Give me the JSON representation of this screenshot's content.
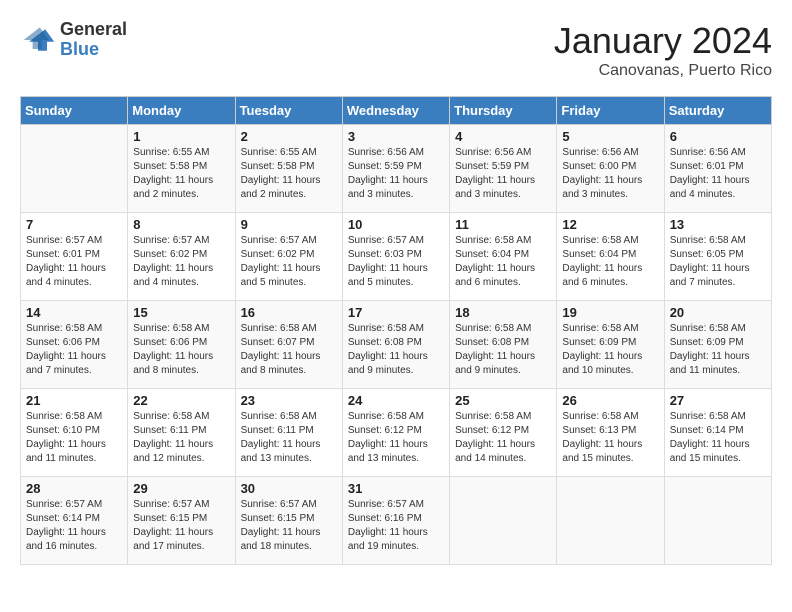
{
  "header": {
    "logo_general": "General",
    "logo_blue": "Blue",
    "month_title": "January 2024",
    "location": "Canovanas, Puerto Rico"
  },
  "days_of_week": [
    "Sunday",
    "Monday",
    "Tuesday",
    "Wednesday",
    "Thursday",
    "Friday",
    "Saturday"
  ],
  "weeks": [
    [
      {
        "day": "",
        "sunrise": "",
        "sunset": "",
        "daylight": ""
      },
      {
        "day": "1",
        "sunrise": "Sunrise: 6:55 AM",
        "sunset": "Sunset: 5:58 PM",
        "daylight": "Daylight: 11 hours and 2 minutes."
      },
      {
        "day": "2",
        "sunrise": "Sunrise: 6:55 AM",
        "sunset": "Sunset: 5:58 PM",
        "daylight": "Daylight: 11 hours and 2 minutes."
      },
      {
        "day": "3",
        "sunrise": "Sunrise: 6:56 AM",
        "sunset": "Sunset: 5:59 PM",
        "daylight": "Daylight: 11 hours and 3 minutes."
      },
      {
        "day": "4",
        "sunrise": "Sunrise: 6:56 AM",
        "sunset": "Sunset: 5:59 PM",
        "daylight": "Daylight: 11 hours and 3 minutes."
      },
      {
        "day": "5",
        "sunrise": "Sunrise: 6:56 AM",
        "sunset": "Sunset: 6:00 PM",
        "daylight": "Daylight: 11 hours and 3 minutes."
      },
      {
        "day": "6",
        "sunrise": "Sunrise: 6:56 AM",
        "sunset": "Sunset: 6:01 PM",
        "daylight": "Daylight: 11 hours and 4 minutes."
      }
    ],
    [
      {
        "day": "7",
        "sunrise": "Sunrise: 6:57 AM",
        "sunset": "Sunset: 6:01 PM",
        "daylight": "Daylight: 11 hours and 4 minutes."
      },
      {
        "day": "8",
        "sunrise": "Sunrise: 6:57 AM",
        "sunset": "Sunset: 6:02 PM",
        "daylight": "Daylight: 11 hours and 4 minutes."
      },
      {
        "day": "9",
        "sunrise": "Sunrise: 6:57 AM",
        "sunset": "Sunset: 6:02 PM",
        "daylight": "Daylight: 11 hours and 5 minutes."
      },
      {
        "day": "10",
        "sunrise": "Sunrise: 6:57 AM",
        "sunset": "Sunset: 6:03 PM",
        "daylight": "Daylight: 11 hours and 5 minutes."
      },
      {
        "day": "11",
        "sunrise": "Sunrise: 6:58 AM",
        "sunset": "Sunset: 6:04 PM",
        "daylight": "Daylight: 11 hours and 6 minutes."
      },
      {
        "day": "12",
        "sunrise": "Sunrise: 6:58 AM",
        "sunset": "Sunset: 6:04 PM",
        "daylight": "Daylight: 11 hours and 6 minutes."
      },
      {
        "day": "13",
        "sunrise": "Sunrise: 6:58 AM",
        "sunset": "Sunset: 6:05 PM",
        "daylight": "Daylight: 11 hours and 7 minutes."
      }
    ],
    [
      {
        "day": "14",
        "sunrise": "Sunrise: 6:58 AM",
        "sunset": "Sunset: 6:06 PM",
        "daylight": "Daylight: 11 hours and 7 minutes."
      },
      {
        "day": "15",
        "sunrise": "Sunrise: 6:58 AM",
        "sunset": "Sunset: 6:06 PM",
        "daylight": "Daylight: 11 hours and 8 minutes."
      },
      {
        "day": "16",
        "sunrise": "Sunrise: 6:58 AM",
        "sunset": "Sunset: 6:07 PM",
        "daylight": "Daylight: 11 hours and 8 minutes."
      },
      {
        "day": "17",
        "sunrise": "Sunrise: 6:58 AM",
        "sunset": "Sunset: 6:08 PM",
        "daylight": "Daylight: 11 hours and 9 minutes."
      },
      {
        "day": "18",
        "sunrise": "Sunrise: 6:58 AM",
        "sunset": "Sunset: 6:08 PM",
        "daylight": "Daylight: 11 hours and 9 minutes."
      },
      {
        "day": "19",
        "sunrise": "Sunrise: 6:58 AM",
        "sunset": "Sunset: 6:09 PM",
        "daylight": "Daylight: 11 hours and 10 minutes."
      },
      {
        "day": "20",
        "sunrise": "Sunrise: 6:58 AM",
        "sunset": "Sunset: 6:09 PM",
        "daylight": "Daylight: 11 hours and 11 minutes."
      }
    ],
    [
      {
        "day": "21",
        "sunrise": "Sunrise: 6:58 AM",
        "sunset": "Sunset: 6:10 PM",
        "daylight": "Daylight: 11 hours and 11 minutes."
      },
      {
        "day": "22",
        "sunrise": "Sunrise: 6:58 AM",
        "sunset": "Sunset: 6:11 PM",
        "daylight": "Daylight: 11 hours and 12 minutes."
      },
      {
        "day": "23",
        "sunrise": "Sunrise: 6:58 AM",
        "sunset": "Sunset: 6:11 PM",
        "daylight": "Daylight: 11 hours and 13 minutes."
      },
      {
        "day": "24",
        "sunrise": "Sunrise: 6:58 AM",
        "sunset": "Sunset: 6:12 PM",
        "daylight": "Daylight: 11 hours and 13 minutes."
      },
      {
        "day": "25",
        "sunrise": "Sunrise: 6:58 AM",
        "sunset": "Sunset: 6:12 PM",
        "daylight": "Daylight: 11 hours and 14 minutes."
      },
      {
        "day": "26",
        "sunrise": "Sunrise: 6:58 AM",
        "sunset": "Sunset: 6:13 PM",
        "daylight": "Daylight: 11 hours and 15 minutes."
      },
      {
        "day": "27",
        "sunrise": "Sunrise: 6:58 AM",
        "sunset": "Sunset: 6:14 PM",
        "daylight": "Daylight: 11 hours and 15 minutes."
      }
    ],
    [
      {
        "day": "28",
        "sunrise": "Sunrise: 6:57 AM",
        "sunset": "Sunset: 6:14 PM",
        "daylight": "Daylight: 11 hours and 16 minutes."
      },
      {
        "day": "29",
        "sunrise": "Sunrise: 6:57 AM",
        "sunset": "Sunset: 6:15 PM",
        "daylight": "Daylight: 11 hours and 17 minutes."
      },
      {
        "day": "30",
        "sunrise": "Sunrise: 6:57 AM",
        "sunset": "Sunset: 6:15 PM",
        "daylight": "Daylight: 11 hours and 18 minutes."
      },
      {
        "day": "31",
        "sunrise": "Sunrise: 6:57 AM",
        "sunset": "Sunset: 6:16 PM",
        "daylight": "Daylight: 11 hours and 19 minutes."
      },
      {
        "day": "",
        "sunrise": "",
        "sunset": "",
        "daylight": ""
      },
      {
        "day": "",
        "sunrise": "",
        "sunset": "",
        "daylight": ""
      },
      {
        "day": "",
        "sunrise": "",
        "sunset": "",
        "daylight": ""
      }
    ]
  ]
}
